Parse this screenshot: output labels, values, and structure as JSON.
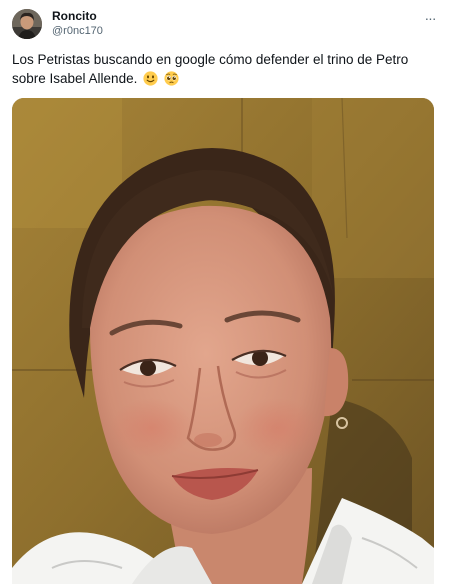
{
  "author": {
    "display_name": "Roncito",
    "handle": "@r0nc170",
    "avatar_icon": "avatar-photo"
  },
  "more_icon": "more-horizontal-icon",
  "more_glyph": "···",
  "tweet": {
    "text": "Los Petristas buscando en google cómo defender el trino de Petro sobre Isabel Allende.",
    "emojis": [
      "slightly-smiling-face-emoji",
      "pleading-face-emoji"
    ]
  },
  "media": {
    "type": "photo"
  },
  "colors": {
    "text_primary": "#0f1419",
    "text_secondary": "#536471",
    "emoji_yellow": "#ffcc4d"
  }
}
